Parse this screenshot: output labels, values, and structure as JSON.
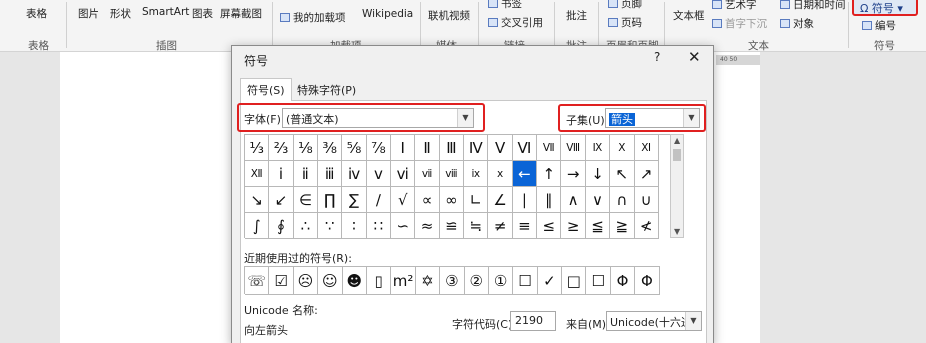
{
  "ribbon": {
    "items": [
      {
        "label": "表格"
      },
      {
        "label": "图片"
      },
      {
        "label": "形状"
      },
      {
        "label": "SmartArt"
      },
      {
        "label": "图表"
      },
      {
        "label": "屏幕截图"
      },
      {
        "label": "我的加载项"
      },
      {
        "label": "Wikipedia"
      },
      {
        "label": "联机视频"
      },
      {
        "label": "书签"
      },
      {
        "label": "交叉引用"
      },
      {
        "label": "批注"
      },
      {
        "label": "页脚"
      },
      {
        "label": "页码"
      },
      {
        "label": "文本框"
      },
      {
        "label": "艺术字"
      },
      {
        "label": "首字下沉"
      },
      {
        "label": "日期和时间"
      },
      {
        "label": "对象"
      },
      {
        "label": "符号"
      },
      {
        "label": "编号"
      }
    ],
    "groups": [
      "表格",
      "插图",
      "加载项",
      "媒体",
      "链接",
      "批注",
      "页眉和页脚",
      "文本",
      "符号"
    ]
  },
  "ruler": {
    "text": "40    50"
  },
  "dialog": {
    "title": "符号",
    "help": "?",
    "close": "✕",
    "tabs": [
      "符号(S)",
      "特殊字符(P)"
    ],
    "font_label": "字体(F):",
    "font_value": "(普通文本)",
    "subset_label": "子集(U):",
    "subset_value": "箭头",
    "grid_symbols": [
      "⅓",
      "⅔",
      "⅛",
      "⅜",
      "⅝",
      "⅞",
      "Ⅰ",
      "Ⅱ",
      "Ⅲ",
      "Ⅳ",
      "Ⅴ",
      "Ⅵ",
      "Ⅶ",
      "Ⅷ",
      "Ⅸ",
      "Ⅹ",
      "Ⅺ",
      "Ⅻ",
      "ⅰ",
      "ⅱ",
      "ⅲ",
      "ⅳ",
      "ⅴ",
      "ⅵ",
      "ⅶ",
      "ⅷ",
      "ⅸ",
      "ⅹ",
      "←",
      "↑",
      "→",
      "↓",
      "↖",
      "↗",
      "↘",
      "↙",
      "∈",
      "∏",
      "∑",
      "∕",
      "√",
      "∝",
      "∞",
      "∟",
      "∠",
      "∣",
      "∥",
      "∧",
      "∨",
      "∩",
      "∪",
      "∫",
      "∮",
      "∴",
      "∵",
      "∶",
      "∷",
      "∽",
      "≈",
      "≌",
      "≒",
      "≠",
      "≡",
      "≤",
      "≥",
      "≦",
      "≧",
      "≮"
    ],
    "recent_label": "近期使用过的符号(R):",
    "recent_symbols": [
      "☏",
      "☑",
      "☹",
      "☺",
      "☻",
      "▯",
      "m²",
      "✡",
      "③",
      "②",
      "①",
      "☐",
      "✓",
      "□",
      "☐",
      "Φ",
      "Φ"
    ],
    "unicode_name_label": "Unicode 名称:",
    "unicode_name": "向左箭头",
    "char_code_label": "字符代码(C):",
    "char_code": "2190",
    "from_label": "来自(M):",
    "from_value": "Unicode(十六进制)"
  }
}
